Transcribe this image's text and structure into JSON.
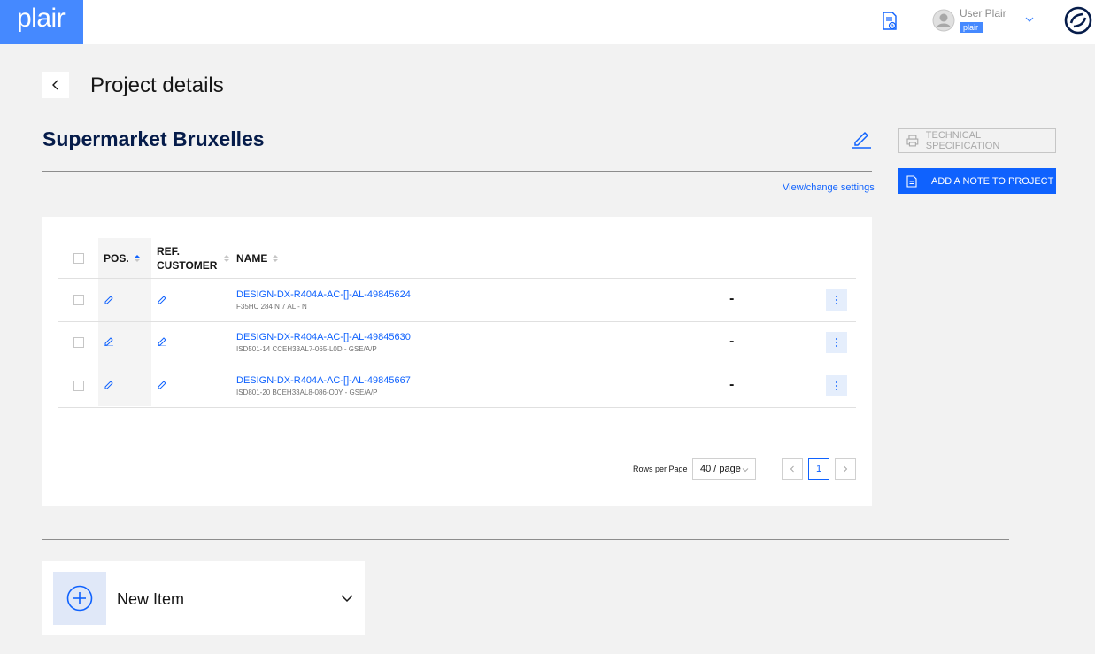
{
  "header": {
    "logo": "plair",
    "user_name": "User Plair",
    "user_badge": "plair"
  },
  "page": {
    "title": "Project details",
    "project_name": "Supermarket Bruxelles",
    "view_settings": "View/change settings"
  },
  "actions": {
    "technical_specification": "TECHNICAL SPECIFICATION",
    "add_note": "ADD A NOTE TO PROJECT"
  },
  "table": {
    "headers": {
      "pos": "POS.",
      "ref_customer_1": "REF.",
      "ref_customer_2": "CUSTOMER",
      "name": "NAME"
    },
    "rows": [
      {
        "name": "DESIGN-DX-R404A-AC-[]-AL-49845624",
        "sub": "F35HC 284 N 7 AL - N",
        "value": "-"
      },
      {
        "name": "DESIGN-DX-R404A-AC-[]-AL-49845630",
        "sub": "ISD501-14 CCEH33AL7-065-L0D - GSE/A/P",
        "value": "-"
      },
      {
        "name": "DESIGN-DX-R404A-AC-[]-AL-49845667",
        "sub": "ISD801-20 BCEH33AL8-086-O0Y - GSE/A/P",
        "value": "-"
      }
    ]
  },
  "pagination": {
    "rows_per_page_label": "Rows per Page",
    "rows_per_page_value": "40 / page",
    "current_page": "1"
  },
  "new_item": {
    "label": "New Item"
  },
  "colors": {
    "brand": "#4589ff",
    "primary": "#0f62fe",
    "title": "#061c4a"
  }
}
